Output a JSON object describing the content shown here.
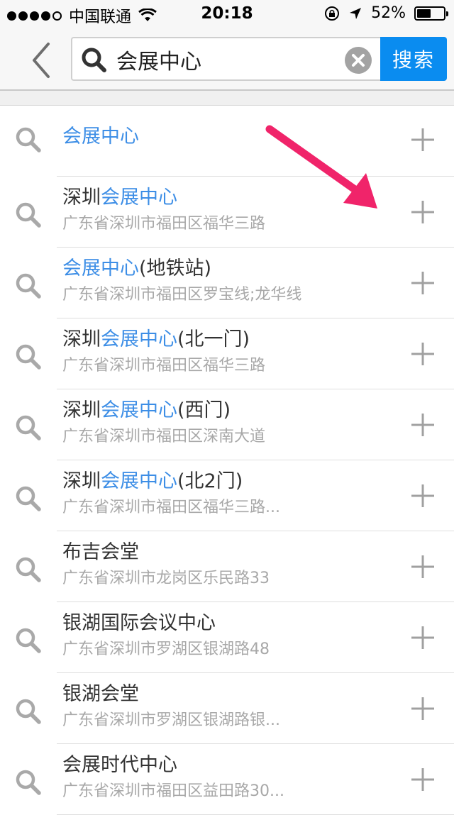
{
  "status": {
    "carrier": "中国联通",
    "time": "20:18",
    "battery": "52%",
    "battery_level": 0.52
  },
  "search": {
    "query": "会展中心",
    "button_label": "搜索"
  },
  "results": [
    {
      "title_pre": "",
      "title_hl": "会展中心",
      "title_post": "",
      "subtitle": ""
    },
    {
      "title_pre": "深圳",
      "title_hl": "会展中心",
      "title_post": "",
      "subtitle": "广东省深圳市福田区福华三路"
    },
    {
      "title_pre": "",
      "title_hl": "会展中心",
      "title_post": "(地铁站)",
      "subtitle": "广东省深圳市福田区罗宝线;龙华线"
    },
    {
      "title_pre": "深圳",
      "title_hl": "会展中心",
      "title_post": "(北一门)",
      "subtitle": "广东省深圳市福田区福华三路"
    },
    {
      "title_pre": "深圳",
      "title_hl": "会展中心",
      "title_post": "(西门)",
      "subtitle": "广东省深圳市福田区深南大道"
    },
    {
      "title_pre": "深圳",
      "title_hl": "会展中心",
      "title_post": "(北2门)",
      "subtitle": "广东省深圳市福田区福华三路..."
    },
    {
      "title_pre": "布吉会堂",
      "title_hl": "",
      "title_post": "",
      "subtitle": "广东省深圳市龙岗区乐民路33"
    },
    {
      "title_pre": "银湖国际会议中心",
      "title_hl": "",
      "title_post": "",
      "subtitle": "广东省深圳市罗湖区银湖路48"
    },
    {
      "title_pre": "银湖会堂",
      "title_hl": "",
      "title_post": "",
      "subtitle": "广东省深圳市罗湖区银湖路银..."
    },
    {
      "title_pre": "会展时代中心",
      "title_hl": "",
      "title_post": "",
      "subtitle": "广东省深圳市福田区益田路30..."
    }
  ],
  "icons": {
    "back": "chevron-left-icon",
    "search": "search-icon",
    "clear": "clear-icon",
    "add": "plus-icon",
    "annotation": "arrow-icon"
  },
  "colors": {
    "accent": "#0a8cf0",
    "highlight": "#3d8ee6",
    "annotation_arrow": "#f0246a"
  }
}
